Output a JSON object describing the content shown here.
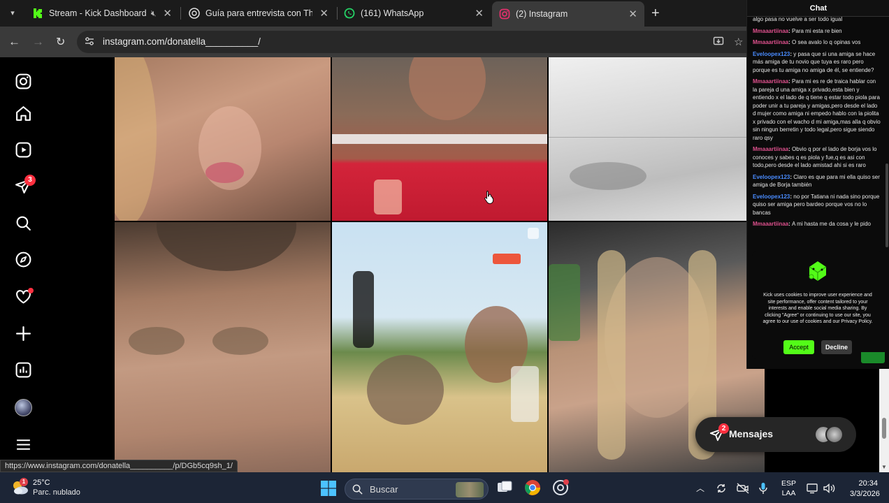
{
  "browser": {
    "tabs": [
      {
        "title": "Stream - Kick Dashboard",
        "icon": "kick-icon",
        "color": "#53fc18",
        "muted": true
      },
      {
        "title": "Guía para entrevista con Thiago",
        "icon": "chatgpt-icon",
        "color": "#ffffff"
      },
      {
        "title": "(161) WhatsApp",
        "icon": "whatsapp-icon",
        "color": "#25d366"
      },
      {
        "title": "(2) Instagram",
        "icon": "instagram-icon",
        "color": "#e1306c",
        "active": true
      }
    ],
    "new_tab_label": "+",
    "url": "instagram.com/donatella__________/"
  },
  "instagram": {
    "notifications_badge": "3",
    "status_url": "https://www.instagram.com/donatella__________/p/DGb5cq9sh_1/",
    "messages": {
      "label": "Mensajes",
      "badge": "2"
    }
  },
  "chat": {
    "header": "Chat",
    "messages": [
      {
        "user": "",
        "text": "algo pasa no vuelve a ser todo igual",
        "color": "none"
      },
      {
        "user": "Mmaaartiinaa",
        "text": "Para mi esta re bien",
        "color": "pink"
      },
      {
        "user": "Mmaaartiinaa",
        "text": "O sea avalo lo q opinas vos",
        "color": "pink"
      },
      {
        "user": "Eveloopex123",
        "text": "y pasa que si una amiga se hace más amiga de tu novio que tuya es raro pero porque es tu amiga no amiga de él, se entiende?",
        "color": "blue"
      },
      {
        "user": "Mmaaartiinaa",
        "text": "Para mi es re de traica hablar con la pareja d una amiga x privado,esta bien y entiendo x el lado de q tiene q estar todo piola para poder unir a tu pareja y amigas,pero desde el lado d mujer como amiga ni empedo hablo con la piolita x privado con el wacho d mi amiga,mas alla q obvio sin ningun berretin y todo legal,pero sigue siendo raro qsy",
        "color": "pink"
      },
      {
        "user": "Mmaaartiinaa",
        "text": "Obvio q por el lado de borja vos lo conoces y sabes q es piola y fue,q es asi con todo,pero desde el lado amistad ahi si es raro",
        "color": "pink"
      },
      {
        "user": "Eveloopex123",
        "text": "Claro es que para mi ella quiso ser amiga de Borja también",
        "color": "blue"
      },
      {
        "user": "Eveloopex123",
        "text": "no por Tatiana ni nada sino porque quiso ser amiga pero bardeo porque vos no lo bancas",
        "color": "blue"
      },
      {
        "user": "Mmaaartiinaa",
        "text": "A mi hasta me da cosa y le pido",
        "color": "pink"
      }
    ],
    "cookie": {
      "text": "Kick uses cookies to improve user experience and site performance, offer content tailored to your interests and enable social media sharing. By clicking \"Agree\" or continuing to use our site, you agree to our use of cookies and our Privacy Policy.",
      "accept": "Accept",
      "decline": "Decline"
    }
  },
  "taskbar": {
    "weather_badge": "1",
    "temperature": "25°C",
    "weather_desc": "Parc. nublado",
    "search_placeholder": "Buscar",
    "lang_1": "ESP",
    "lang_2": "LAA",
    "time": "20:34",
    "date": "3/3/2026"
  },
  "colors": {
    "kick_green": "#53fc18",
    "instagram_badge": "#ff3040",
    "chat_user_pink": "#e0518e",
    "chat_user_blue": "#4a8cff"
  }
}
